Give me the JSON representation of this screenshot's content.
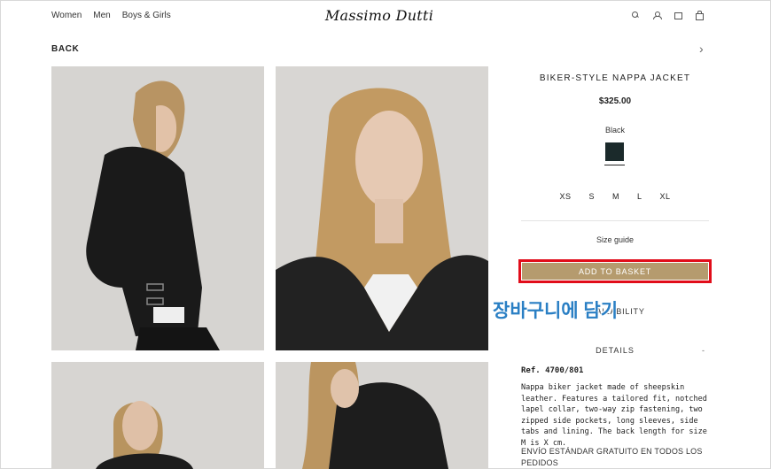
{
  "header": {
    "nav": [
      "Women",
      "Men",
      "Boys & Girls"
    ],
    "logo": "Massimo Dutti",
    "icons": [
      "search-icon",
      "user-icon",
      "wishlist-icon",
      "bag-icon"
    ]
  },
  "back_label": "BACK",
  "product": {
    "title": "BIKER-STYLE NAPPA JACKET",
    "price": "$325.00",
    "color_name": "Black",
    "swatch_color": "#1b2a2b",
    "sizes": [
      "XS",
      "S",
      "M",
      "L",
      "XL"
    ],
    "size_guide": "Size guide",
    "add_to_basket": "ADD TO BASKET",
    "availability": "AVAILABILITY",
    "details_title": "DETAILS",
    "details_toggle": "-",
    "ref": "Ref. 4700/801",
    "description": "Nappa biker jacket made of sheepskin leather. Features a tailored fit, notched lapel collar, two-way zip fastening, two zipped side pockets, long sleeves, side tabs and lining. The back length for size M is X cm.",
    "shipping": "ENVÍO ESTÁNDAR GRATUITO EN TODOS LOS PEDIDOS"
  },
  "annotation": {
    "text": "장바구니에 담기",
    "highlight_color": "#e10d1a",
    "text_color": "#2a7fc4"
  },
  "colors": {
    "button_bg": "#b59b6e"
  }
}
